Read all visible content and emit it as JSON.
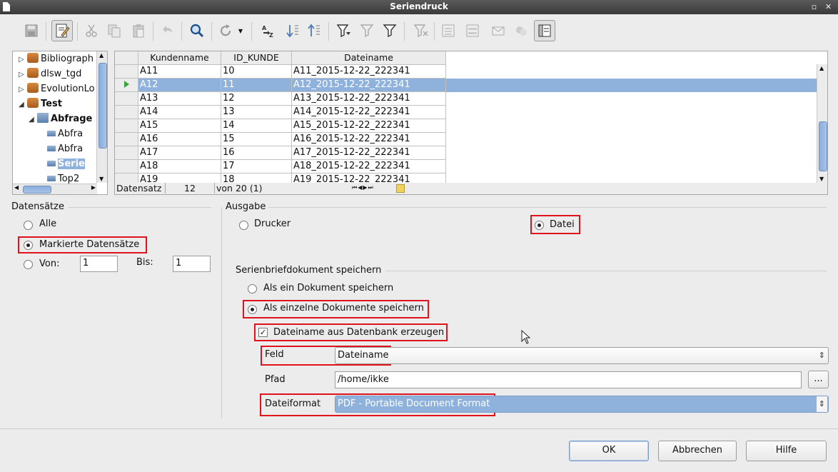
{
  "window": {
    "title": "Seriendruck"
  },
  "tree": {
    "items": [
      {
        "label": "Bibliograph",
        "bold": false,
        "expander": "▷"
      },
      {
        "label": "dlsw_tgd",
        "bold": false,
        "expander": "▷"
      },
      {
        "label": "EvolutionLo",
        "bold": false,
        "expander": "▷"
      },
      {
        "label": "Test",
        "bold": true,
        "expander": "◢"
      },
      {
        "label": "Abfrage",
        "bold": true,
        "expander": "◢"
      },
      {
        "label": "Abfra",
        "bold": false,
        "expander": ""
      },
      {
        "label": "Abfra",
        "bold": false,
        "expander": ""
      },
      {
        "label": "Serie",
        "bold": true,
        "expander": ""
      },
      {
        "label": "Top2",
        "bold": false,
        "expander": ""
      }
    ]
  },
  "grid": {
    "columns": [
      "Kundenname",
      "ID_KUNDE",
      "Dateiname"
    ],
    "rows": [
      [
        "A11",
        "10",
        "A11_2015-12-22_222341"
      ],
      [
        "A12",
        "11",
        "A12_2015-12-22_222341"
      ],
      [
        "A13",
        "12",
        "A13_2015-12-22_222341"
      ],
      [
        "A14",
        "13",
        "A14_2015-12-22_222341"
      ],
      [
        "A15",
        "14",
        "A15_2015-12-22_222341"
      ],
      [
        "A16",
        "15",
        "A16_2015-12-22_222341"
      ],
      [
        "A17",
        "16",
        "A17_2015-12-22_222341"
      ],
      [
        "A18",
        "17",
        "A18_2015-12-22_222341"
      ],
      [
        "A19",
        "18",
        "A19_2015-12-22_222341"
      ]
    ],
    "selected_row": 1,
    "nav": {
      "label": "Datensatz",
      "current": "12",
      "of": "von 20 (1)"
    }
  },
  "datensaetze": {
    "title": "Datensätze",
    "alle": "Alle",
    "markierte": "Markierte Datensätze",
    "von": "Von:",
    "von_value": "1",
    "bis": "Bis:",
    "bis_value": "1"
  },
  "ausgabe": {
    "title": "Ausgabe",
    "drucker": "Drucker",
    "datei": "Datei"
  },
  "speichern": {
    "title": "Serienbriefdokument speichern",
    "ein_dokument": "Als ein Dokument speichern",
    "einzelne": "Als einzelne Dokumente speichern",
    "dateiname_db": "Dateiname aus Datenbank erzeugen",
    "feld_label": "Feld",
    "feld_value": "Dateiname",
    "pfad_label": "Pfad",
    "pfad_value": "/home/ikke",
    "browse": "...",
    "format_label": "Dateiformat",
    "format_value": "PDF - Portable Document Format"
  },
  "buttons": {
    "ok": "OK",
    "cancel": "Abbrechen",
    "help": "Hilfe"
  }
}
